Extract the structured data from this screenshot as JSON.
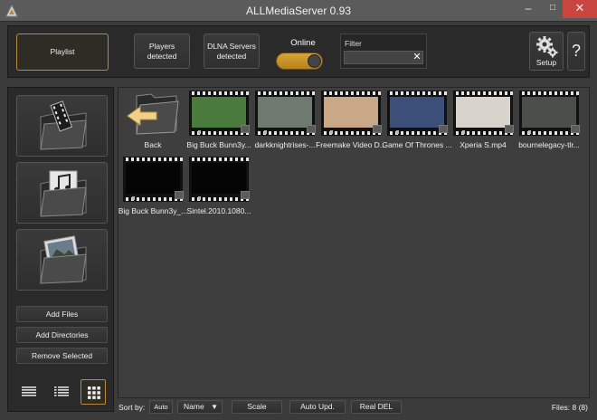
{
  "window": {
    "title": "ALLMediaServer 0.93",
    "minimize_glyph": "–",
    "maximize_glyph": "□",
    "close_glyph": "✕"
  },
  "toolbar": {
    "playlist_label": "Playlist",
    "players_label_1": "Players",
    "players_label_2": "detected",
    "dlna_label_1": "DLNA Servers",
    "dlna_label_2": "detected",
    "online_label": "Online",
    "online_state": "on",
    "filter_label": "Filter",
    "filter_value": "",
    "filter_clear_glyph": "✕",
    "setup_label": "Setup",
    "help_label": "?"
  },
  "sidebar": {
    "categories": [
      "video-folder-icon",
      "music-folder-icon",
      "photo-folder-icon"
    ],
    "add_files": "Add Files",
    "add_directories": "Add Directories",
    "remove_selected": "Remove Selected",
    "views": [
      "details-view-icon",
      "list-view-icon",
      "grid-view-icon"
    ],
    "active_view": "grid"
  },
  "main": {
    "back_label": "Back",
    "items": [
      {
        "label": "Big Buck Bunn3y...",
        "thumb_color": "#4a7a3c"
      },
      {
        "label": "darkknightrises-...",
        "thumb_color": "#6e7a70"
      },
      {
        "label": "Freemake Video D...",
        "thumb_color": "#c9a887"
      },
      {
        "label": "Game Of Thrones ...",
        "thumb_color": "#3c4f78"
      },
      {
        "label": "Xperia S.mp4",
        "thumb_color": "#d8d4cc"
      },
      {
        "label": "bournelegacy-tlr...",
        "thumb_color": "#4b4e4a"
      },
      {
        "label": "Big Buck Bunn3y_...",
        "thumb_color": "#050505"
      },
      {
        "label": "Sintel.2010.1080...",
        "thumb_color": "#050505"
      }
    ]
  },
  "statusbar": {
    "sort_by_label": "Sort by:",
    "auto_label": "Auto",
    "sort_selected": "Name",
    "scale_label": "Scale",
    "auto_upd_label": "Auto Upd.",
    "real_del_label": "Real DEL",
    "files_count": "Files: 8 (8)"
  },
  "colors": {
    "accent": "#b8893a",
    "toggle_on": "#d9a431",
    "close_button": "#c7463f"
  }
}
